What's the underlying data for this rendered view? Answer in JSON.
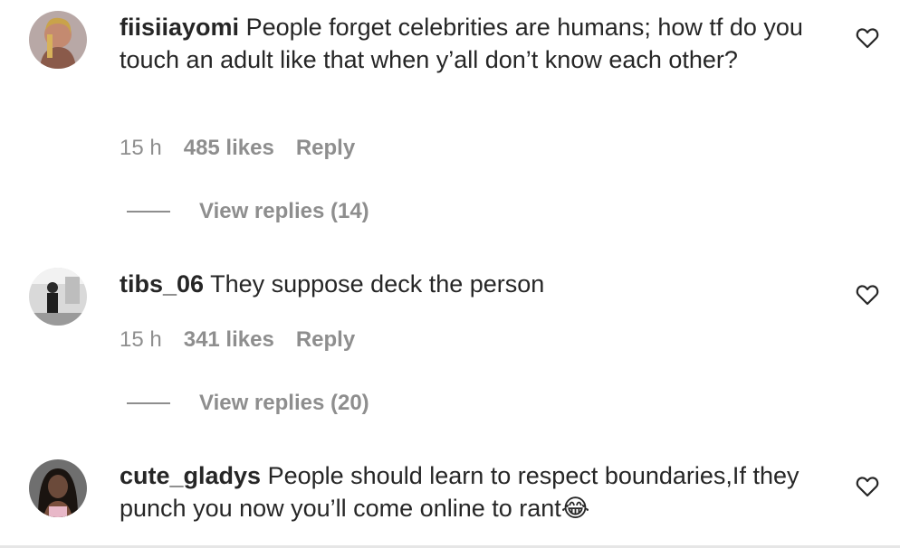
{
  "comments": [
    {
      "username": "fiisiiayomi",
      "text": "People forget celebrities are humans; how tf do you touch an adult like that when y’all don’t know each other?",
      "time": "15 h",
      "likes": "485 likes",
      "reply_label": "Reply",
      "view_replies": "View replies (14)",
      "avatar_icon": "profile-photo"
    },
    {
      "username": "tibs_06",
      "text": "They suppose deck the person",
      "time": "15 h",
      "likes": "341 likes",
      "reply_label": "Reply",
      "view_replies": "View replies (20)",
      "avatar_icon": "profile-photo"
    },
    {
      "username": "cute_gladys",
      "text": "People should learn to respect boundaries,If they punch you now you’ll come online to rant😂",
      "avatar_icon": "profile-photo"
    }
  ],
  "icons": {
    "like": "heart-outline-icon"
  },
  "colors": {
    "text": "#262626",
    "meta": "#8e8e8e"
  }
}
